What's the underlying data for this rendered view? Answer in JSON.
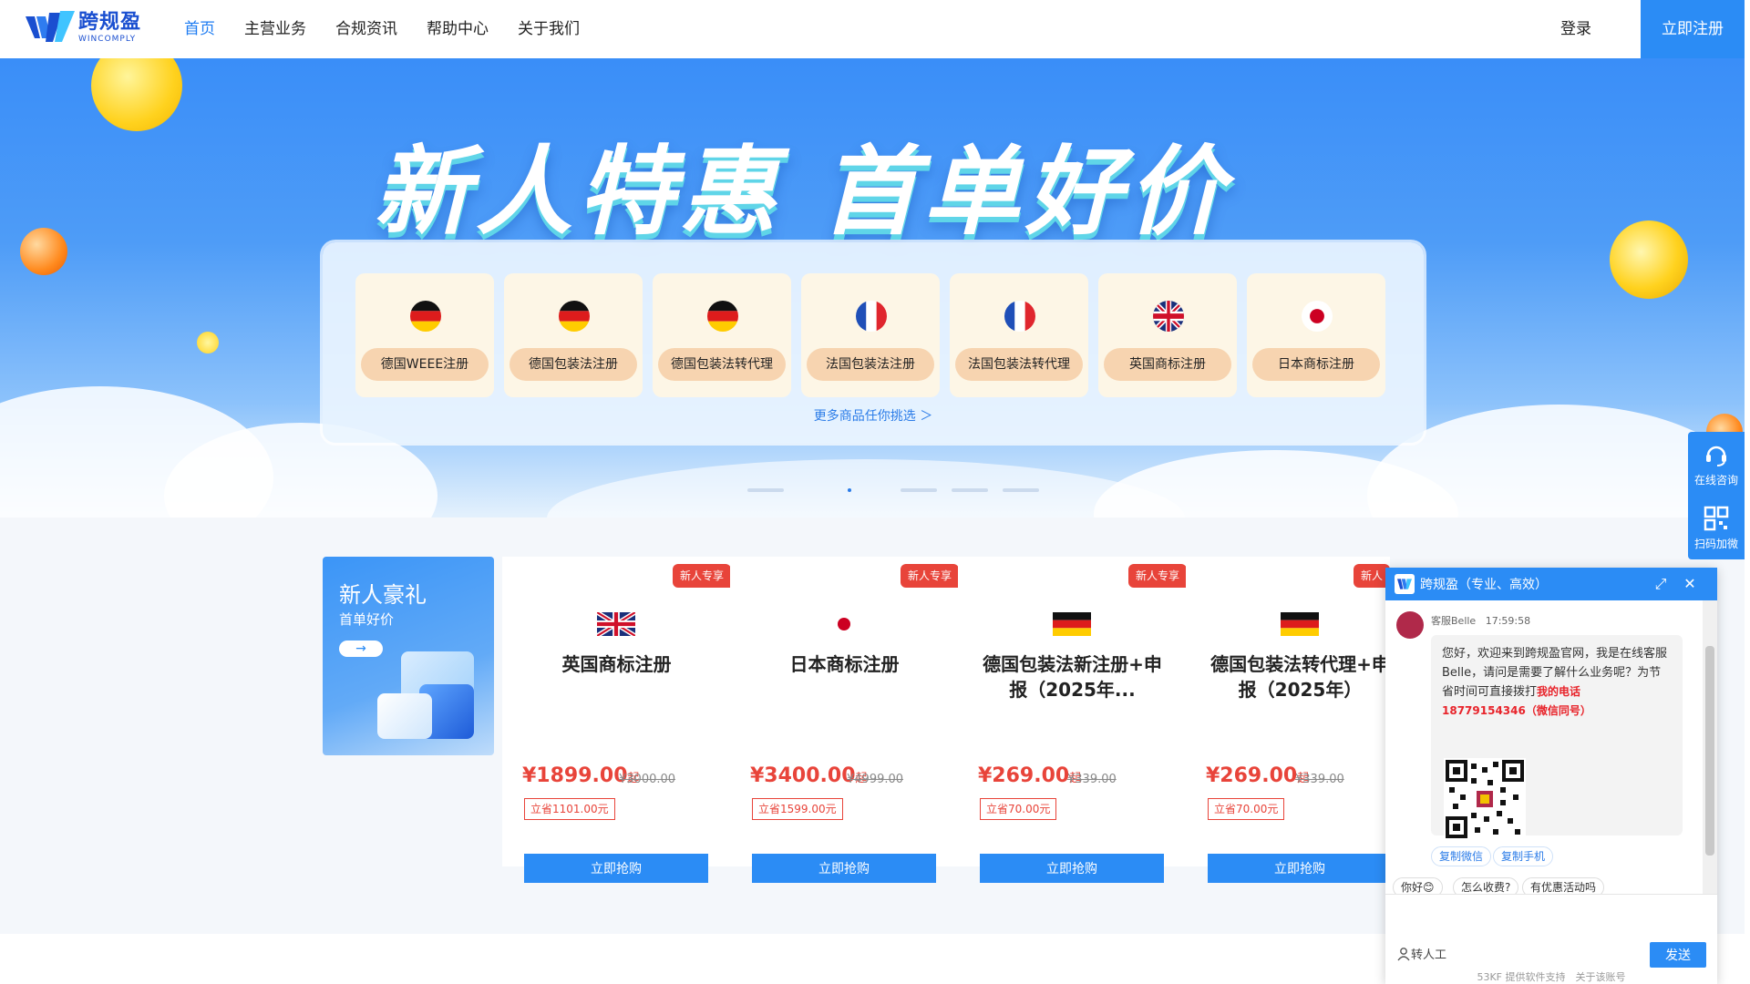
{
  "header": {
    "logo_cn": "跨规盈",
    "logo_en": "WINCOMPLY",
    "nav": [
      "首页",
      "主营业务",
      "合规资讯",
      "帮助中心",
      "关于我们"
    ],
    "login": "登录",
    "register": "立即注册"
  },
  "banner": {
    "title": "新人特惠 首单好价",
    "offers": [
      {
        "label": "德国WEEE注册",
        "flag": "de"
      },
      {
        "label": "德国包装法注册",
        "flag": "de"
      },
      {
        "label": "德国包装法转代理",
        "flag": "de"
      },
      {
        "label": "法国包装法注册",
        "flag": "fr"
      },
      {
        "label": "法国包装法转代理",
        "flag": "fr"
      },
      {
        "label": "英国商标注册",
        "flag": "uk"
      },
      {
        "label": "日本商标注册",
        "flag": "jp"
      }
    ],
    "more": "更多商品任你挑选 ＞",
    "slide_count": 5,
    "active_slide": 2
  },
  "promo": {
    "title": "新人豪礼",
    "subtitle": "首单好价",
    "arrow": "→"
  },
  "products": [
    {
      "badge": "新人专享",
      "flag": "uk",
      "name": "英国商标注册",
      "price": "¥1899.00",
      "price_suffix": "起",
      "original": "¥3000.00",
      "save": "立省1101.00元",
      "buy": "立即抢购"
    },
    {
      "badge": "新人专享",
      "flag": "jp",
      "name": "日本商标注册",
      "price": "¥3400.00",
      "price_suffix": "起",
      "original": "¥4999.00",
      "save": "立省1599.00元",
      "buy": "立即抢购"
    },
    {
      "badge": "新人专享",
      "flag": "de",
      "name": "德国包装法新注册+申报（2025年...",
      "price": "¥269.00",
      "price_suffix": "起",
      "original": "¥339.00",
      "save": "立省70.00元",
      "buy": "立即抢购"
    },
    {
      "badge": "新人",
      "flag": "de",
      "name": "德国包装法转代理+申报（2025年）",
      "price": "¥269.00",
      "price_suffix": "起",
      "original": "¥339.00",
      "save": "立省70.00元",
      "buy": "立即抢购"
    }
  ],
  "side": {
    "consult": "在线咨询",
    "scan": "扫码加微"
  },
  "chat": {
    "title": "跨规盈（专业、高效）",
    "agent": "客服Belle",
    "time": "17:59:58",
    "message": "您好，欢迎来到跨规盈官网，我是在线客服Belle，请问是需要了解什么业务呢？为节省时间可直接拨打",
    "phone_label": "我的电话",
    "phone": "18779154346（微信同号）",
    "copy_wechat": "复制微信",
    "copy_phone": "复制手机",
    "quick": [
      "你好😊",
      "怎么收费?",
      "有优惠活动吗"
    ],
    "transfer": "转人工",
    "send": "发送",
    "powered": "53KF 提供软件支持　关于该账号"
  },
  "colors": {
    "primary": "#2b8cf5",
    "nav_active": "#1e7cf2",
    "price_red": "#e8443a",
    "offer_bg": "#fdf6e6",
    "offer_label_bg": "#f7d4b0"
  }
}
